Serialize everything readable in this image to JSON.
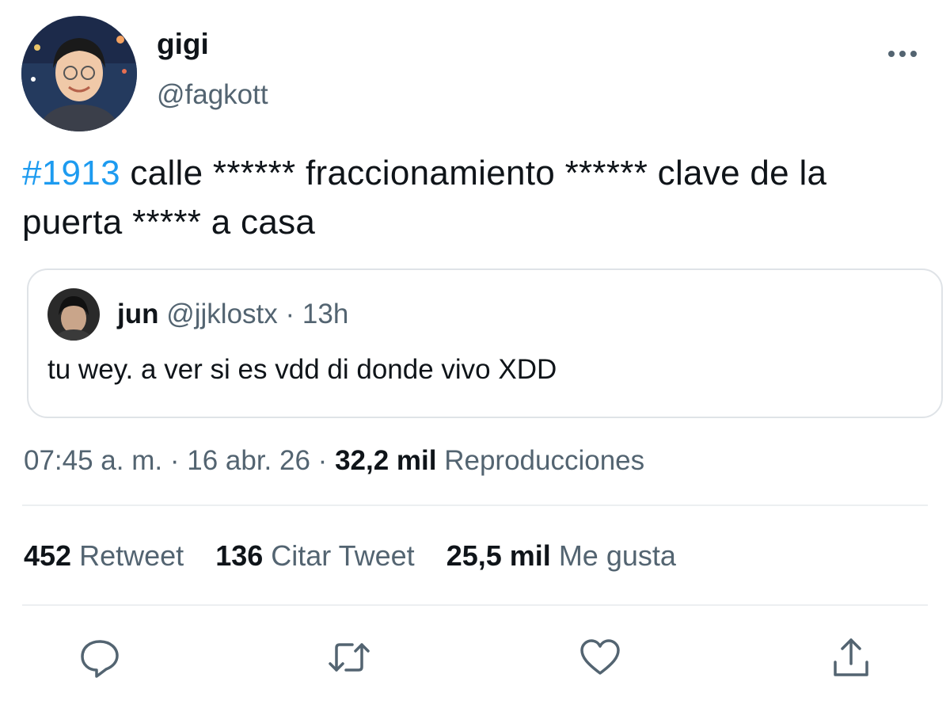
{
  "author": {
    "display_name": "gigi",
    "handle": "@fagkott"
  },
  "tweet": {
    "hashtag": "#1913",
    "text": " calle ****** fraccionamiento ****** clave de la puerta ***** a casa"
  },
  "quote": {
    "name": "jun",
    "handle": "@jjklostx",
    "separator": "·",
    "time": "13h",
    "text": "tu wey. a ver si es vdd di donde vivo XDD"
  },
  "meta": {
    "time": "07:45 a. m.",
    "sep1": "·",
    "date": "16 abr. 26",
    "sep2": "·",
    "views_count": "32,2 mil",
    "views_label": "Reproducciones"
  },
  "stats": [
    {
      "count": "452",
      "label": "Retweet"
    },
    {
      "count": "136",
      "label": "Citar Tweet"
    },
    {
      "count": "25,5 mil",
      "label": "Me gusta"
    }
  ],
  "icons": {
    "more": "more-horizontal-icon",
    "reply": "reply-icon",
    "retweet": "retweet-icon",
    "like": "heart-icon",
    "share": "share-icon"
  },
  "colors": {
    "accent": "#1d9bf0",
    "text": "#0f1419",
    "secondary": "#536471",
    "border": "#dfe3e7"
  }
}
